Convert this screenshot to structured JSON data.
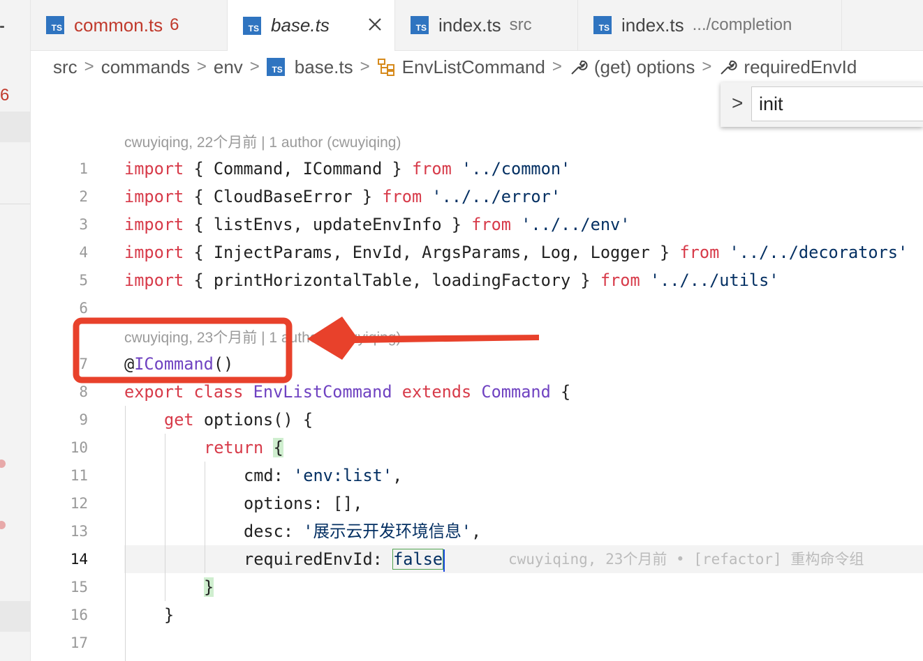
{
  "activity": {
    "badge": "6"
  },
  "tabs": [
    {
      "label": "common.ts",
      "badge": "6",
      "description": "",
      "state": "error"
    },
    {
      "label": "base.ts",
      "badge": "",
      "description": "",
      "state": "active"
    },
    {
      "label": "index.ts",
      "badge": "",
      "description": "src",
      "state": "normal"
    },
    {
      "label": "index.ts",
      "badge": "",
      "description": ".../completion",
      "state": "normal"
    }
  ],
  "file_icon_text": "TS",
  "breadcrumb": {
    "items": [
      "src",
      "commands",
      "env",
      "base.ts",
      "EnvListCommand",
      "(get) options",
      "requiredEnvId"
    ]
  },
  "find_widget": {
    "value": "init"
  },
  "codelens": {
    "top": "cwuyiqing, 22个月前 | 1 author (cwuyiqing)",
    "class": "cwuyiqing, 23个月前 | 1 author (cwuyiqing)"
  },
  "inline_blame": "cwuyiqing, 23个月前 • [refactor] 重构命令组",
  "code": {
    "l1": {
      "n": "1",
      "a": "import",
      "b": " { Command, ICommand } ",
      "c": "from",
      "d": " '../common'"
    },
    "l2": {
      "n": "2",
      "a": "import",
      "b": " { CloudBaseError } ",
      "c": "from",
      "d": " '../../error'"
    },
    "l3": {
      "n": "3",
      "a": "import",
      "b": " { listEnvs, updateEnvInfo } ",
      "c": "from",
      "d": " '../../env'"
    },
    "l4": {
      "n": "4",
      "a": "import",
      "b": " { InjectParams, EnvId, ArgsParams, Log, Logger } ",
      "c": "from",
      "d": " '../../decorators'"
    },
    "l5": {
      "n": "5",
      "a": "import",
      "b": " { printHorizontalTable, loadingFactory } ",
      "c": "from",
      "d": " '../../utils'"
    },
    "l6": {
      "n": "6"
    },
    "l7": {
      "n": "7",
      "at": "@",
      "name": "ICommand",
      "rest": "()"
    },
    "l8": {
      "n": "8",
      "k1": "export",
      "k2": " class ",
      "name": "EnvListCommand",
      "k3": " extends ",
      "base": "Command",
      "rest": " {"
    },
    "l9": {
      "n": "9",
      "k": "get",
      "rest": " options() {"
    },
    "l10": {
      "n": "10",
      "k": "return",
      "brace": "{"
    },
    "l11": {
      "n": "11",
      "key": "cmd: ",
      "val": "'env:list'",
      "rest": ","
    },
    "l12": {
      "n": "12",
      "text": "options: [],"
    },
    "l13": {
      "n": "13",
      "key": "desc: ",
      "val": "'展示云开发环境信息'",
      "rest": ","
    },
    "l14": {
      "n": "14",
      "key": "requiredEnvId: ",
      "val": "false"
    },
    "l15": {
      "n": "15",
      "brace": "}"
    },
    "l16": {
      "n": "16",
      "text": "}"
    },
    "l17": {
      "n": "17"
    }
  },
  "colors": {
    "annotation": "#e8412b",
    "keyword": "#d73a49",
    "string": "#032f62",
    "class": "#6f42c1"
  }
}
